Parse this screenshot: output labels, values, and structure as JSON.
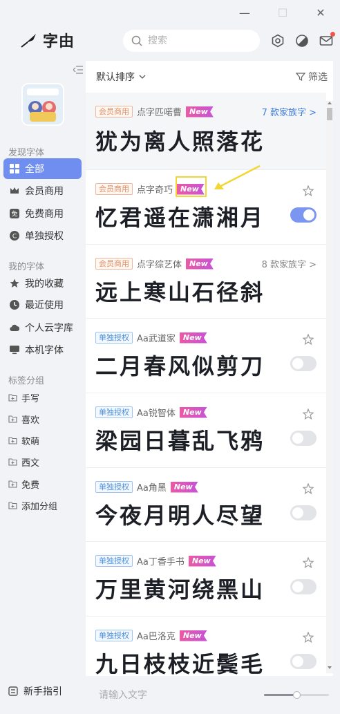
{
  "window": {
    "minimize_glyph": "—",
    "maximize_glyph": "☐",
    "close_glyph": "✕"
  },
  "app": {
    "name": "字由"
  },
  "search": {
    "placeholder": "搜索",
    "value": ""
  },
  "sidebar": {
    "discover_title": "发现字体",
    "discover_items": [
      {
        "label": "全部",
        "icon": "grid-icon",
        "active": true
      },
      {
        "label": "会员商用",
        "icon": "crown-icon",
        "active": false
      },
      {
        "label": "免费商用",
        "icon": "free-icon",
        "active": false
      },
      {
        "label": "单独授权",
        "icon": "license-icon",
        "active": false
      }
    ],
    "my_title": "我的字体",
    "my_items": [
      {
        "label": "我的收藏",
        "icon": "star-icon"
      },
      {
        "label": "最近使用",
        "icon": "clock-icon"
      },
      {
        "label": "个人云字库",
        "icon": "cloud-icon"
      },
      {
        "label": "本机字体",
        "icon": "monitor-icon"
      }
    ],
    "tags_title": "标签分组",
    "tags": [
      "手写",
      "喜欢",
      "软萌",
      "西文",
      "免费",
      "添加分组"
    ],
    "guide_label": "新手指引"
  },
  "main": {
    "sort_label": "默认排序",
    "filter_label": "筛选",
    "new_label": "New",
    "fonts": [
      {
        "license": "会员商用",
        "license_type": "vip",
        "name": "点字匹喏曹",
        "is_new": true,
        "family": "7 款家族字 >",
        "family_style": "blue",
        "sample": "犹为离人照落花",
        "star": false,
        "toggle": null
      },
      {
        "license": "会员商用",
        "license_type": "vip",
        "name": "点字奇巧",
        "is_new": true,
        "family": "",
        "family_style": "",
        "sample": "忆君遥在潇湘月",
        "star": true,
        "toggle": true
      },
      {
        "license": "会员商用",
        "license_type": "vip",
        "name": "点字综艺体",
        "is_new": true,
        "family": "8 款家族字 >",
        "family_style": "gray",
        "sample": "远上寒山石径斜",
        "star": false,
        "toggle": null
      },
      {
        "license": "单独授权",
        "license_type": "solo",
        "name": "Aa武道家",
        "is_new": true,
        "family": "",
        "family_style": "",
        "sample": "二月春风似剪刀",
        "star": true,
        "toggle": false
      },
      {
        "license": "单独授权",
        "license_type": "solo",
        "name": "Aa锐智体",
        "is_new": true,
        "family": "",
        "family_style": "",
        "sample": "梁园日暮乱飞鸦",
        "star": true,
        "toggle": false
      },
      {
        "license": "单独授权",
        "license_type": "solo",
        "name": "Aa角黑",
        "is_new": true,
        "family": "",
        "family_style": "",
        "sample": "今夜月明人尽望",
        "star": true,
        "toggle": false
      },
      {
        "license": "单独授权",
        "license_type": "solo",
        "name": "Aa丁香手书",
        "is_new": true,
        "family": "",
        "family_style": "",
        "sample": "万里黄河绕黑山",
        "star": true,
        "toggle": false
      },
      {
        "license": "单独授权",
        "license_type": "solo",
        "name": "Aa巴洛克",
        "is_new": true,
        "family": "",
        "family_style": "",
        "sample": "九日枝枝近鬓毛",
        "star": true,
        "toggle": false
      }
    ]
  },
  "bottom": {
    "input_placeholder": "请输入文字",
    "input_value": "",
    "size_slider_fraction": 0.5
  },
  "colors": {
    "accent": "#6f8ef0",
    "new_tag": "#e255b8",
    "highlight": "#f2d634",
    "notification": "#f2544a"
  }
}
